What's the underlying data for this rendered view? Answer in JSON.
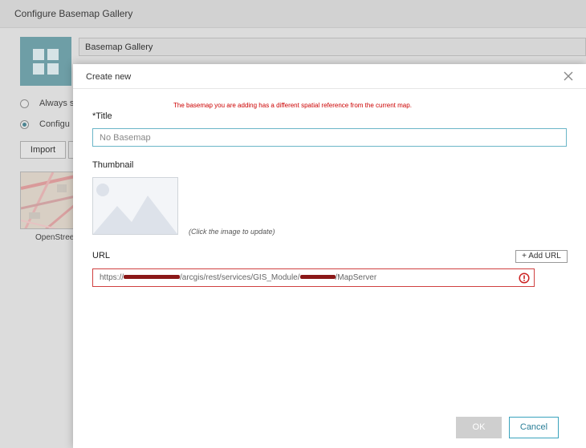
{
  "background_dialog": {
    "title": "Configure Basemap Gallery",
    "name_value": "Basemap Gallery",
    "options": [
      {
        "label": "Always s",
        "checked": false
      },
      {
        "label": "Configu",
        "checked": true
      }
    ],
    "import_label": "Import",
    "map_label": "OpenStree"
  },
  "modal": {
    "title": "Create new",
    "warning": "The basemap you are adding has a different spatial reference from the current map.",
    "title_label": "*Title",
    "title_value": "No Basemap",
    "thumbnail_label": "Thumbnail",
    "thumbnail_hint": "(Click the image to update)",
    "url_label": "URL",
    "add_url_label": "+ Add URL",
    "url_parts": {
      "prefix": "https://",
      "middle": "/arcgis/rest/services/GIS_Module/",
      "suffix": "/MapServer"
    },
    "ok_label": "OK",
    "cancel_label": "Cancel"
  },
  "colors": {
    "accent": "#3aa3bd",
    "error": "#cc0000",
    "widget_icon": "#6e9ea6",
    "ok_disabled": "#cfcfcf"
  },
  "icons": {
    "close": "close-icon",
    "error": "error-icon",
    "thumbnail": "image-placeholder-icon",
    "widget": "grid-icon"
  }
}
